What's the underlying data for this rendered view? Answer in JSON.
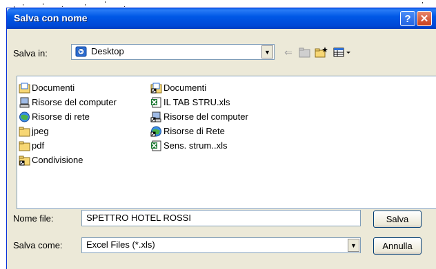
{
  "dialog": {
    "title": "Salva con nome",
    "help_label": "?",
    "close_label": "✕"
  },
  "location": {
    "label": "Salva in:",
    "value": "Desktop"
  },
  "files": {
    "left": [
      {
        "name": "Documenti",
        "icon": "my-documents-icon"
      },
      {
        "name": "Risorse del computer",
        "icon": "my-computer-icon"
      },
      {
        "name": "Risorse di rete",
        "icon": "network-places-icon"
      },
      {
        "name": "jpeg",
        "icon": "folder-icon"
      },
      {
        "name": "pdf",
        "icon": "folder-icon"
      },
      {
        "name": "Condivisione",
        "icon": "folder-shortcut-icon"
      }
    ],
    "right": [
      {
        "name": "Documenti",
        "icon": "documents-shortcut-icon"
      },
      {
        "name": "IL TAB STRU.xls",
        "icon": "excel-file-icon"
      },
      {
        "name": "Risorse del computer",
        "icon": "computer-shortcut-icon"
      },
      {
        "name": "Risorse di Rete",
        "icon": "network-shortcut-icon"
      },
      {
        "name": "Sens. strum..xls",
        "icon": "excel-file-icon"
      }
    ]
  },
  "filename": {
    "label": "Nome file:",
    "value": "SPETTRO HOTEL ROSSI"
  },
  "filetype": {
    "label": "Salva come:",
    "value": "Excel Files (*.xls)"
  },
  "buttons": {
    "save": "Salva",
    "cancel": "Annulla"
  },
  "colors": {
    "titlebar": "#0058e6",
    "dialog_bg": "#ece9d8",
    "field_border": "#7f9db9"
  }
}
